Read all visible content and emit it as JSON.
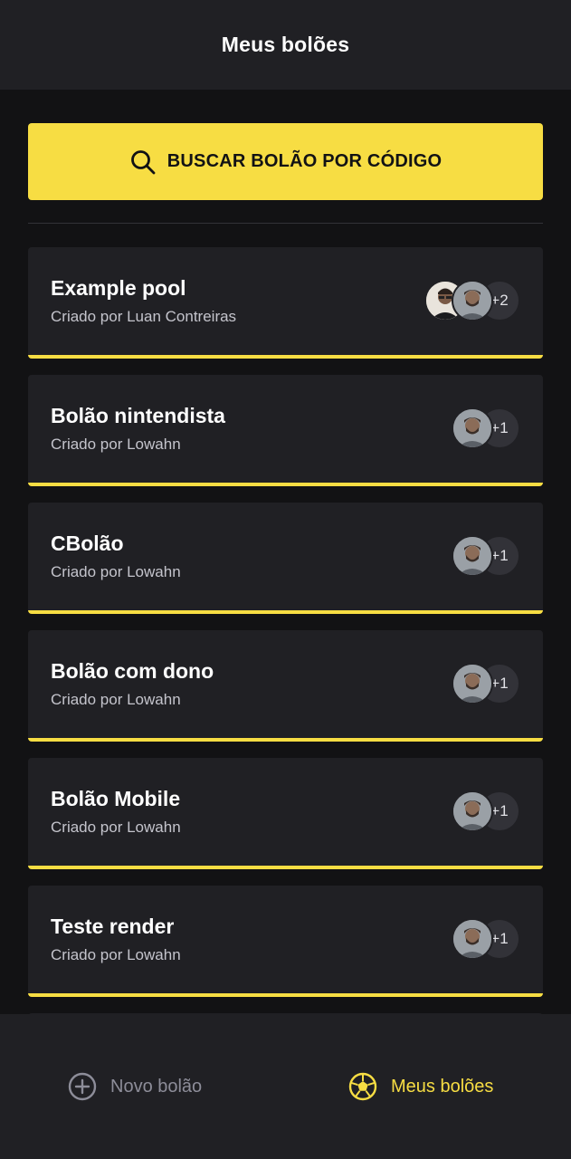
{
  "header": {
    "title": "Meus bolões"
  },
  "search": {
    "label": "BUSCAR BOLÃO POR CÓDIGO",
    "icon": "search-icon"
  },
  "pools": [
    {
      "name": "Example pool",
      "owner": "Criado por Luan Contreiras",
      "extra_count": "+2"
    },
    {
      "name": "Bolão nintendista",
      "owner": "Criado por Lowahn",
      "extra_count": "+1"
    },
    {
      "name": "CBolão",
      "owner": "Criado por Lowahn",
      "extra_count": "+1"
    },
    {
      "name": "Bolão com dono",
      "owner": "Criado por Lowahn",
      "extra_count": "+1"
    },
    {
      "name": "Bolão Mobile",
      "owner": "Criado por Lowahn",
      "extra_count": "+1"
    },
    {
      "name": "Teste render",
      "owner": "Criado por Lowahn",
      "extra_count": "+1"
    }
  ],
  "tabbar": {
    "new_label": "Novo bolão",
    "new_icon": "plus-circle-icon",
    "mine_label": "Meus bolões",
    "mine_icon": "soccer-ball-icon",
    "active": "Meus bolões"
  },
  "colors": {
    "background": "#121214",
    "surface": "#202024",
    "accent": "#F7DD43",
    "text_primary": "#FFFFFF",
    "text_secondary": "#C4C4CC",
    "text_muted": "#8D8D99"
  }
}
